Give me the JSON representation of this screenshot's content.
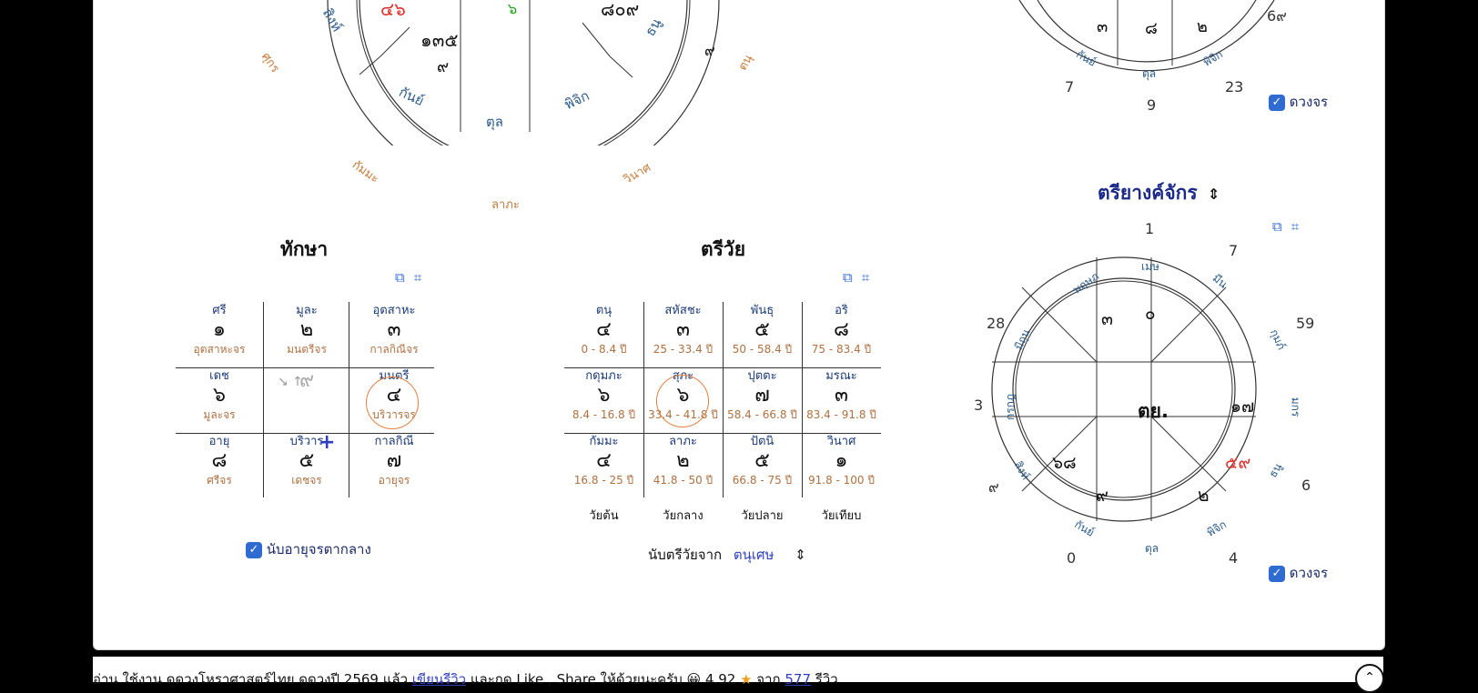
{
  "colors": {
    "accent": "#2f6bd1",
    "orange": "#c87a3a",
    "red": "#e0302a",
    "green": "#1aa31a",
    "navy": "#1b3a7a"
  },
  "top_chart": {
    "signs_visible": [
      "สิงห์",
      "กันย์",
      "ตุล",
      "พิจิก",
      "ธนู"
    ],
    "cells": [
      "๔๖",
      "๖",
      "๘๐๙",
      "๑๓๕",
      "๙"
    ],
    "outer_labels": [
      "ศุกร",
      "ตนุ",
      "กัมมะ",
      "วินาศ",
      "ลาภะ"
    ],
    "outer_number": "๙"
  },
  "top_right_chart": {
    "cells": [
      "๓",
      "๘",
      "๒"
    ],
    "signs": [
      "กันย์",
      "ตุล",
      "พิจิก"
    ],
    "outer_numbers": [
      "7",
      "9",
      "23",
      "6๙"
    ],
    "checkbox_label": "ดวงจร"
  },
  "taksa": {
    "title": "ทักษา",
    "cells": [
      {
        "top": "ศรี",
        "mid": "๑",
        "bot": "อุตสาหะจร"
      },
      {
        "top": "มูละ",
        "mid": "๒",
        "bot": "มนตรีจร"
      },
      {
        "top": "อุตสาหะ",
        "mid": "๓",
        "bot": "กาลกิณีจร"
      },
      {
        "top": "เดช",
        "mid": "๖",
        "bot": "มูละจร"
      },
      {
        "top": "",
        "mid": "๙",
        "bot": ""
      },
      {
        "top": "มนตรี",
        "mid": "๔",
        "bot": "บริวารจร"
      },
      {
        "top": "อายุ",
        "mid": "๘",
        "bot": "ศรีจร"
      },
      {
        "top": "บริวาร",
        "mid": "๕",
        "bot": "เดชจร"
      },
      {
        "top": "กาลกิณี",
        "mid": "๗",
        "bot": "อายุจร"
      }
    ],
    "checkbox_label": "นับอายุจรตากลาง"
  },
  "triwai": {
    "title": "ตรีวัย",
    "cells": [
      {
        "top": "ตนุ",
        "mid": "๔",
        "bot": "0 - 8.4 ปี"
      },
      {
        "top": "สหัสชะ",
        "mid": "๓",
        "bot": "25 - 33.4 ปี"
      },
      {
        "top": "พันธุ",
        "mid": "๕",
        "bot": "50 - 58.4 ปี"
      },
      {
        "top": "อริ",
        "mid": "๘",
        "bot": "75 - 83.4 ปี"
      },
      {
        "top": "กดุมภะ",
        "mid": "๖",
        "bot": "8.4 - 16.8 ปี"
      },
      {
        "top": "สุภะ",
        "mid": "๖",
        "bot": "33.4 - 41.8 ปี"
      },
      {
        "top": "ปุตตะ",
        "mid": "๗",
        "bot": "58.4 - 66.8 ปี"
      },
      {
        "top": "มรณะ",
        "mid": "๓",
        "bot": "83.4 - 91.8 ปี"
      },
      {
        "top": "กัมมะ",
        "mid": "๔",
        "bot": "16.8 - 25 ปี"
      },
      {
        "top": "ลาภะ",
        "mid": "๒",
        "bot": "41.8 - 50 ปี"
      },
      {
        "top": "ปัตนิ",
        "mid": "๕",
        "bot": "66.8 - 75 ปี"
      },
      {
        "top": "วินาศ",
        "mid": "๑",
        "bot": "91.8 - 100 ปี"
      }
    ],
    "ages": [
      "วัยต้น",
      "วัยกลาง",
      "วัยปลาย",
      "วัยเทียบ"
    ],
    "count_label": "นับตรีวัยจาก",
    "count_value": "ตนุเศษ"
  },
  "triyang": {
    "title": "ตรียางค์จักร",
    "center": "ตย.",
    "signs": [
      "เมษ",
      "มีน",
      "กุมภ์",
      "มกร",
      "ธนู",
      "พิจิก",
      "ตุล",
      "กันย์",
      "สิงห์",
      "กรกฎ",
      "มิถุน",
      "พฤษภ"
    ],
    "cells": [
      "๓",
      "๐",
      "๑๗",
      "๕๙",
      "๒",
      "๙",
      "๖๘"
    ],
    "outer_numbers": [
      "1",
      "7",
      "59",
      "6",
      "4",
      "0",
      "๙",
      "3",
      "28"
    ],
    "checkbox_label": "ดวงจร"
  },
  "footer": {
    "prefix": "อ่าน ใช้งาน ดูดวงโหราศาสตร์ไทย ดูดวงปี 2569 แล้ว ",
    "review_link": "เขียนรีวิว",
    "middle": " และกด Like , Share ให้ด้วยนะครับ 😀  4.92 ",
    "from": " จาก ",
    "count": "577",
    "suffix": " รีวิว"
  }
}
